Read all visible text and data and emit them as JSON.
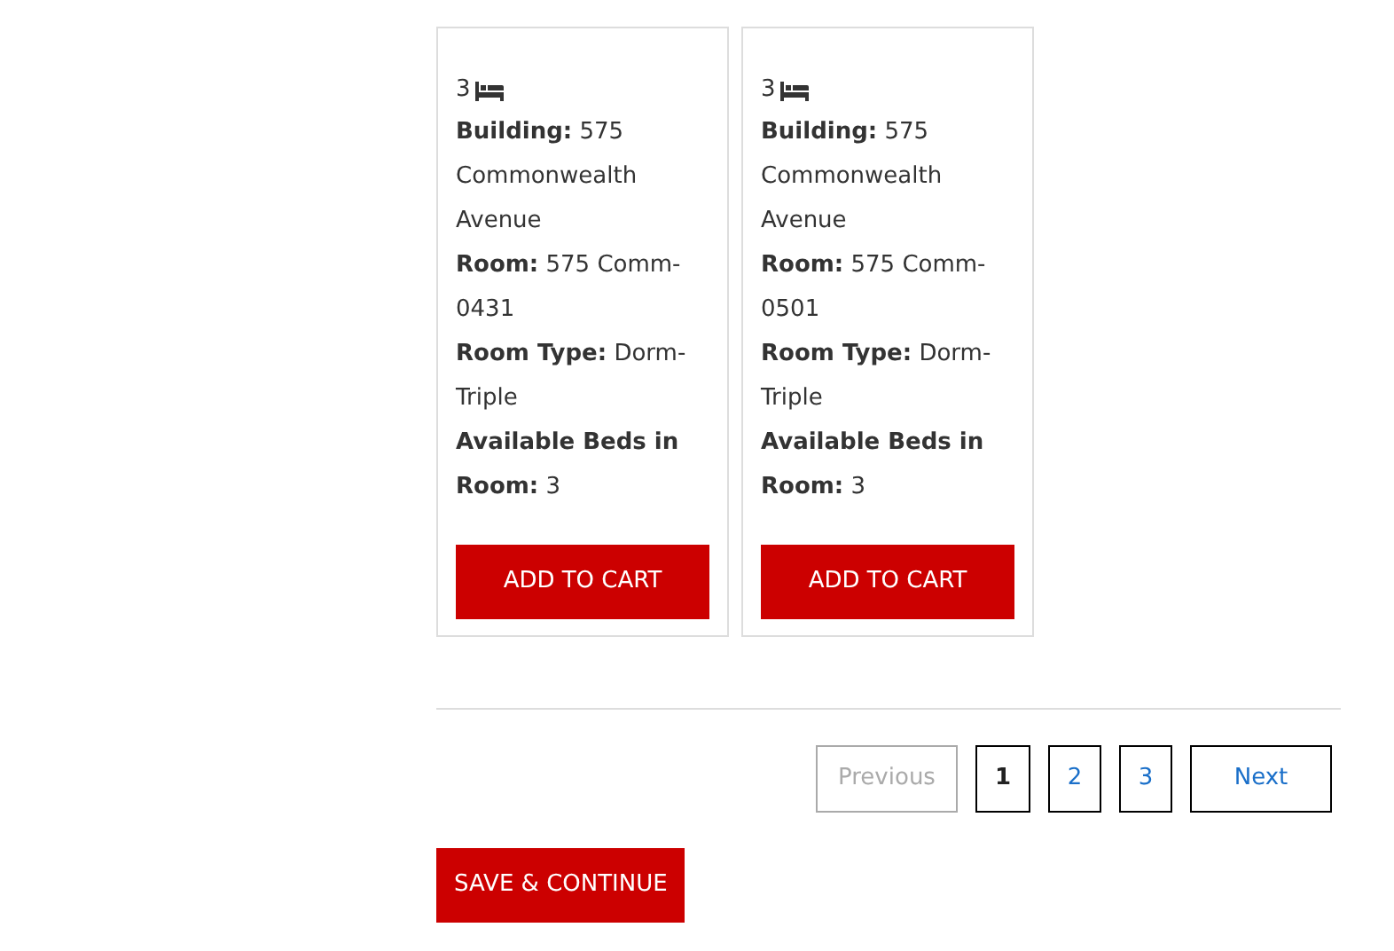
{
  "cards": [
    {
      "beds": "3",
      "lines": [
        "**Building:** 575 Commonwealth Avenue",
        "**Room:** 575 Comm-0431",
        "**Room Type:** Dorm-Triple",
        "**Available Beds in Room:** 3"
      ],
      "button": "ADD TO CART"
    },
    {
      "beds": "3",
      "lines": [
        "**Building:** 575 Commonwealth Avenue",
        "**Room:** 575 Comm-0501",
        "**Room Type:** Dorm-Triple",
        "**Available Beds in Room:** 3"
      ],
      "button": "ADD TO CART"
    }
  ],
  "pagination": {
    "previous": {
      "label": "Previous",
      "disabled": true
    },
    "pages": [
      {
        "label": "1",
        "selected": true
      },
      {
        "label": "2",
        "selected": false
      },
      {
        "label": "3",
        "selected": false
      }
    ],
    "next": {
      "label": "Next",
      "disabled": false
    }
  },
  "save_button": "SAVE & CONTINUE"
}
